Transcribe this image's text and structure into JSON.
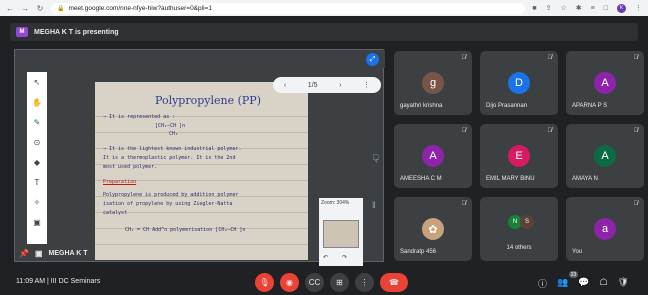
{
  "browser": {
    "url": "meet.google.com/nne-nfye-hiw?authuser=0&pli=1",
    "icons": [
      "back-icon",
      "forward-icon",
      "reload-icon",
      "lock-icon",
      "camera-icon",
      "share-icon",
      "star-icon",
      "extension-icon",
      "queue-icon",
      "sync-icon"
    ],
    "profile_initial": "K"
  },
  "meeting": {
    "presenter_initial": "M",
    "presenter_banner": "MEGHA K T is presenting",
    "presenter_name": "MEGHA K T",
    "time": "11:09 AM",
    "separator": "|",
    "meeting_title": "III DC Seminars",
    "participant_count": "23"
  },
  "presentation": {
    "page_indicator": "1/5",
    "zoom_label": "Zoom: 304%",
    "note": {
      "title": "Polypropylene (PP)",
      "lines": [
        "→ It is represented as :",
        "[CH₂–CH ]n",
        "CH₃",
        "→ It is the lightest known industrial polymer.",
        "It is a thermoplastic polymer. It is the 2nd",
        "most used polymer.",
        "Preparation",
        "Polypropylene is produced by addition polymer",
        "isation of propylene by using Ziegler-Natta",
        "catalyst",
        "CH₂ = CH   Add^n polymerisation   [CH₂–CH ]n"
      ]
    }
  },
  "participants": [
    {
      "name": "gayathri krishna",
      "initial": "g",
      "color": "#795548"
    },
    {
      "name": "Dijo Prasannan",
      "initial": "D",
      "color": "#1a73e8"
    },
    {
      "name": "APARNA P S",
      "initial": "A",
      "color": "#8e24aa"
    },
    {
      "name": "AMEESHA C M",
      "initial": "A",
      "color": "#8e24aa"
    },
    {
      "name": "EMIL MARY BINU",
      "initial": "E",
      "color": "#d81b60"
    },
    {
      "name": "AMAYA N",
      "initial": "A",
      "color": "#0b6b44"
    },
    {
      "name": "Sandratp 456",
      "initial": "",
      "color": "#c8a27b"
    },
    {
      "name": "14 others",
      "initial": "N S",
      "color": "#188038"
    },
    {
      "name": "You",
      "initial": "a",
      "color": "#8e24aa"
    }
  ],
  "colors": {
    "end_call": "#ea4335",
    "accent": "#1a73e8"
  }
}
